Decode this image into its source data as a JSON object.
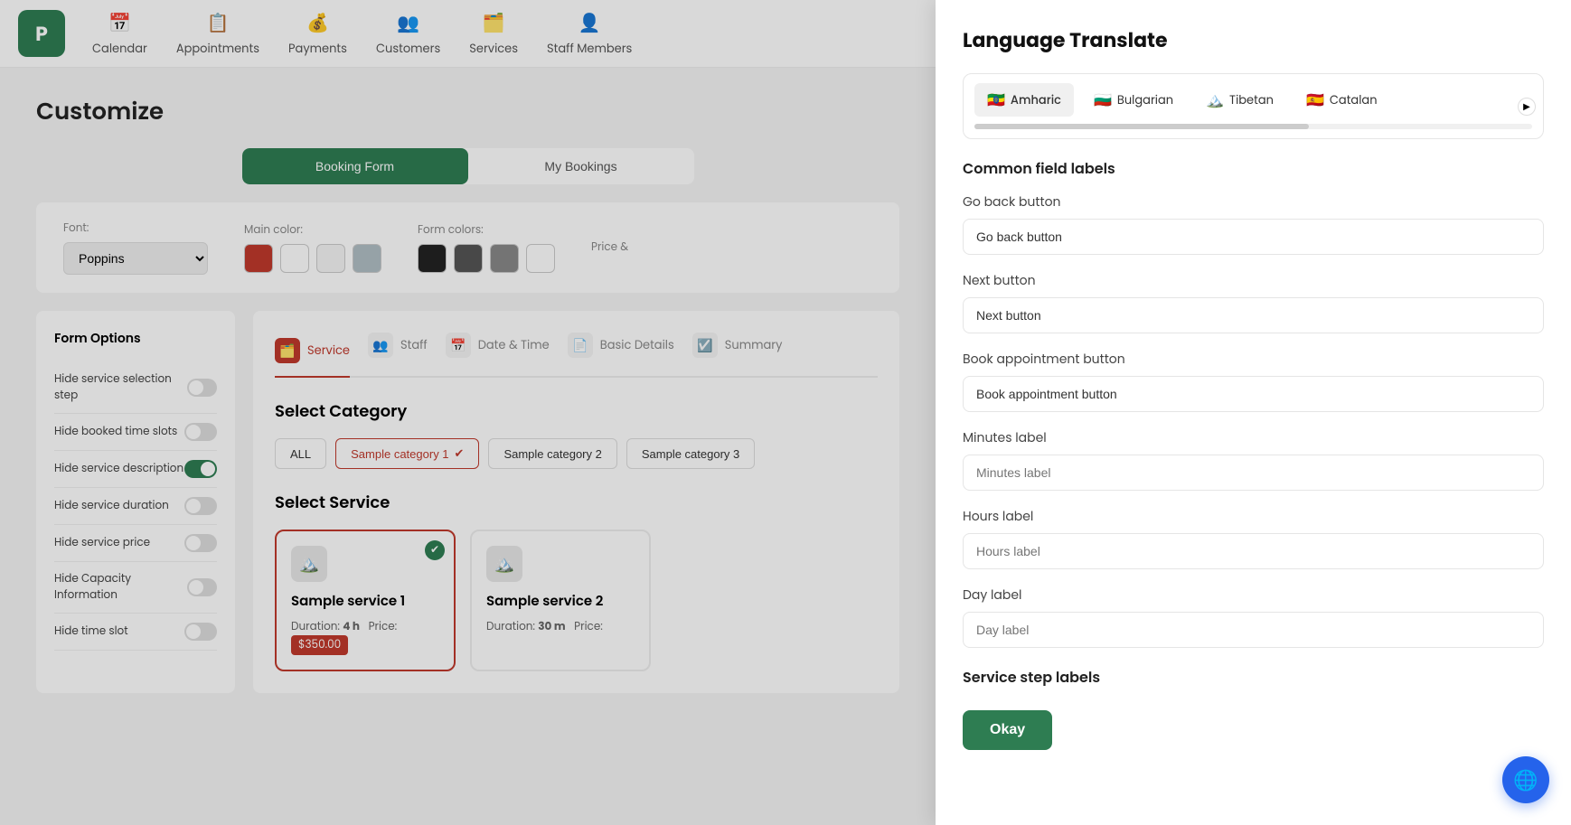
{
  "nav": {
    "logo_text": "P",
    "items": [
      {
        "id": "calendar",
        "label": "Calendar",
        "icon": "📅"
      },
      {
        "id": "appointments",
        "label": "Appointments",
        "icon": "📋"
      },
      {
        "id": "payments",
        "label": "Payments",
        "icon": "💰"
      },
      {
        "id": "customers",
        "label": "Customers",
        "icon": "👥"
      },
      {
        "id": "services",
        "label": "Services",
        "icon": "🗂️"
      },
      {
        "id": "staff",
        "label": "Staff Members",
        "icon": "👤"
      }
    ]
  },
  "page": {
    "title": "Customize",
    "tabs": [
      {
        "id": "booking-form",
        "label": "Booking Form",
        "active": true
      },
      {
        "id": "my-bookings",
        "label": "My Bookings",
        "active": false
      }
    ]
  },
  "options_row": {
    "font_label": "Font:",
    "font_value": "Poppins",
    "main_color_label": "Main color:",
    "form_colors_label": "Form colors:",
    "price_label": "Price &"
  },
  "sidebar": {
    "title": "Form Options",
    "toggles": [
      {
        "id": "hide-service-selection",
        "label": "Hide service selection step",
        "on": false
      },
      {
        "id": "hide-booked-slots",
        "label": "Hide booked time slots",
        "on": false
      },
      {
        "id": "hide-service-description",
        "label": "Hide service description",
        "on": true
      },
      {
        "id": "hide-service-duration",
        "label": "Hide service duration",
        "on": false
      },
      {
        "id": "hide-service-price",
        "label": "Hide service price",
        "on": false
      },
      {
        "id": "hide-capacity",
        "label": "Hide Capacity Information",
        "on": false
      },
      {
        "id": "hide-time-slot",
        "label": "Hide time slot",
        "on": false
      }
    ]
  },
  "booking_preview": {
    "steps": [
      {
        "id": "service",
        "label": "Service",
        "icon": "🗂️",
        "active": true
      },
      {
        "id": "staff",
        "label": "Staff",
        "icon": "👥",
        "active": false
      },
      {
        "id": "date-time",
        "label": "Date & Time",
        "icon": "📅",
        "active": false
      },
      {
        "id": "basic-details",
        "label": "Basic Details",
        "icon": "📄",
        "active": false
      },
      {
        "id": "summary",
        "label": "Summary",
        "icon": "☑️",
        "active": false
      }
    ],
    "select_category_title": "Select Category",
    "categories": [
      {
        "id": "all",
        "label": "ALL",
        "active": false
      },
      {
        "id": "cat1",
        "label": "Sample category 1",
        "active": true
      },
      {
        "id": "cat2",
        "label": "Sample category 2",
        "active": false
      },
      {
        "id": "cat3",
        "label": "Sample category 3",
        "active": false
      }
    ],
    "select_service_title": "Select Service",
    "services": [
      {
        "id": "service1",
        "name": "Sample service 1",
        "duration_label": "Duration:",
        "duration": "4 h",
        "price_label": "Price:",
        "price": "$350.00",
        "selected": true
      },
      {
        "id": "service2",
        "name": "Sample service 2",
        "duration_label": "Duration:",
        "duration": "30 m",
        "price_label": "Price:",
        "price": "",
        "selected": false
      }
    ]
  },
  "right_panel": {
    "title": "Language Translate",
    "languages": [
      {
        "id": "amharic",
        "label": "Amharic",
        "flag": "🇪🇹",
        "active": true
      },
      {
        "id": "bulgarian",
        "label": "Bulgarian",
        "flag": "🇧🇬",
        "active": false
      },
      {
        "id": "tibetan",
        "label": "Tibetan",
        "flag": "🏔️",
        "active": false
      },
      {
        "id": "catalan",
        "label": "Catalan",
        "flag": "🇪🇸",
        "active": false
      }
    ],
    "common_section_title": "Common field labels",
    "fields": [
      {
        "id": "go-back",
        "label": "Go back button",
        "placeholder": "Go back button",
        "value": "Go back button"
      },
      {
        "id": "next",
        "label": "Next button",
        "placeholder": "Next button",
        "value": "Next button"
      },
      {
        "id": "book-appt",
        "label": "Book appointment button",
        "placeholder": "Book appointment button",
        "value": "Book appointment button"
      },
      {
        "id": "minutes",
        "label": "Minutes label",
        "placeholder": "Minutes label",
        "value": ""
      },
      {
        "id": "hours",
        "label": "Hours label",
        "placeholder": "Hours label",
        "value": ""
      },
      {
        "id": "day",
        "label": "Day label",
        "placeholder": "Day label",
        "value": ""
      }
    ],
    "service_step_title": "Service step labels",
    "okay_btn_label": "Okay"
  },
  "help": {
    "icon": "🌐"
  }
}
